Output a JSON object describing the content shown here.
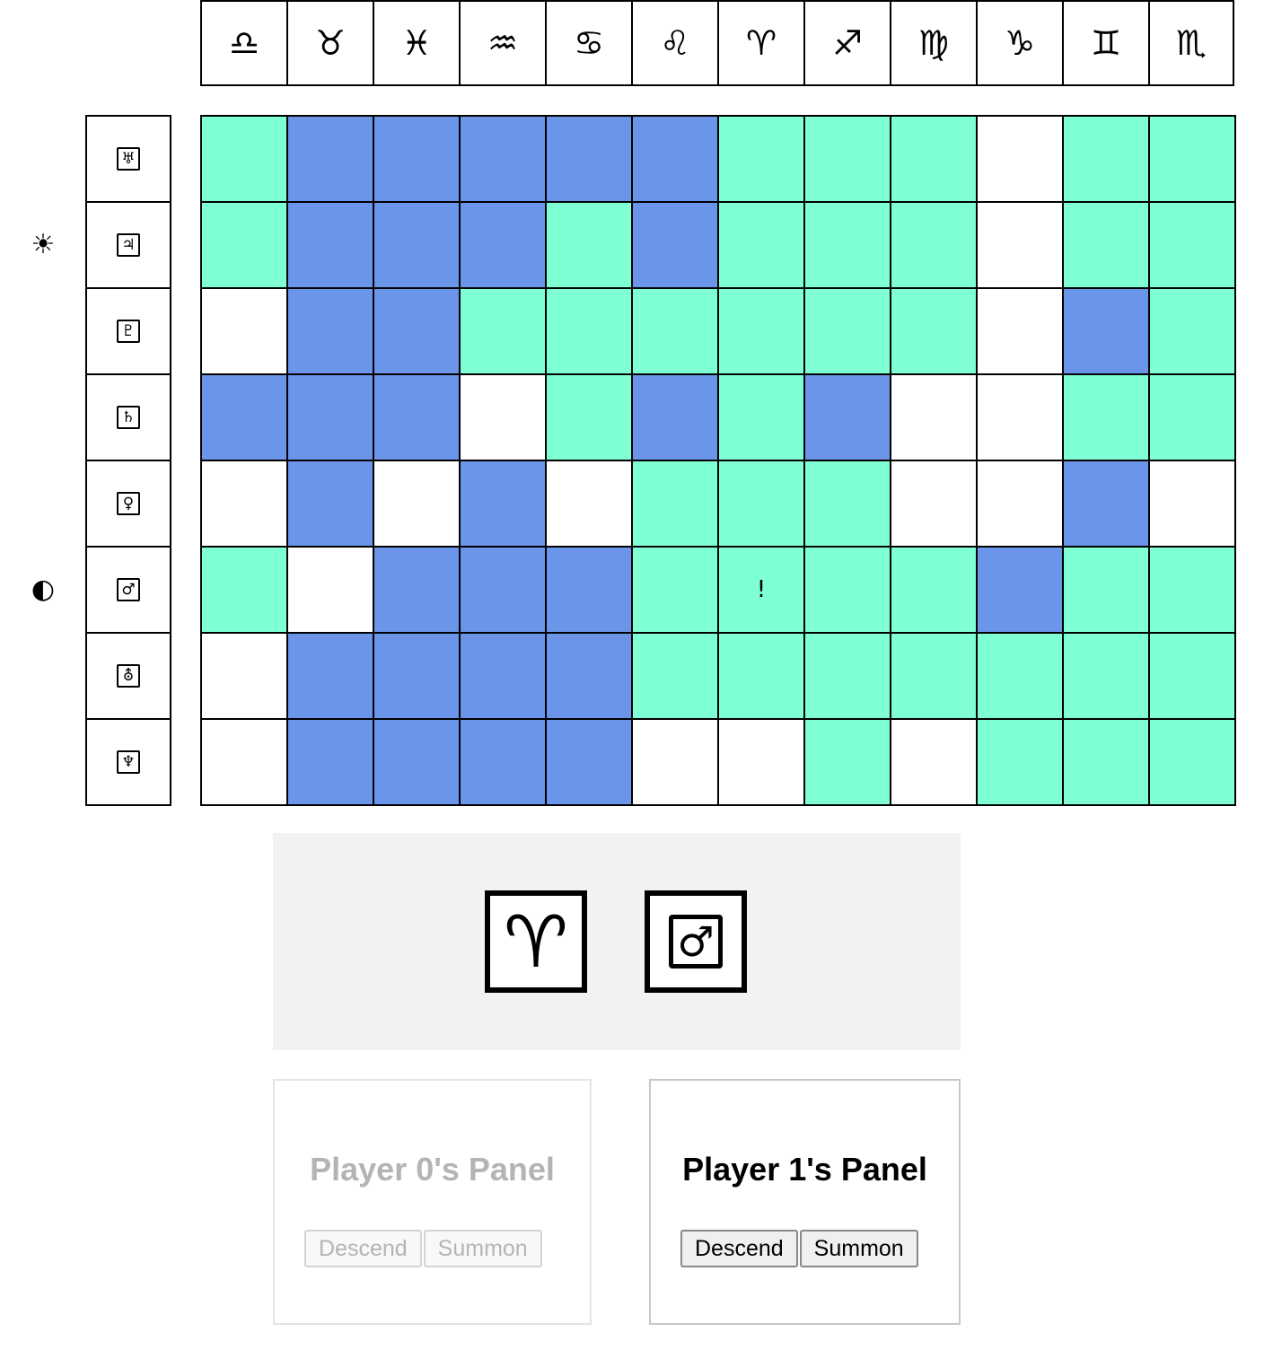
{
  "header": {
    "signs": [
      "♎",
      "♉",
      "♓",
      "♒",
      "♋",
      "♌",
      "♈",
      "♐",
      "♍",
      "♑",
      "♊",
      "♏"
    ],
    "sign_names": [
      "libra-icon",
      "taurus-icon",
      "pisces-icon",
      "aquarius-icon",
      "cancer-icon",
      "leo-icon",
      "aries-icon",
      "sagittarius-icon",
      "virgo-icon",
      "capricorn-icon",
      "gemini-icon",
      "scorpio-icon"
    ]
  },
  "planets": {
    "symbols": [
      "♅",
      "♃",
      "♇",
      "♄",
      "♀",
      "♂",
      "⛢",
      "♆"
    ],
    "names": [
      "uranus-icon",
      "jupiter-icon",
      "pluto-icon",
      "saturn-icon",
      "venus-icon",
      "mars-icon",
      "uranus-alt-icon",
      "neptune-icon"
    ]
  },
  "markers": {
    "sun": "☀",
    "moon": "◐",
    "sun_row": 1,
    "moon_row": 5
  },
  "colors": {
    "type_a": "#7fffd4",
    "type_b": "#6a95e9",
    "empty": "#ffffff"
  },
  "board": {
    "rows": [
      [
        "a",
        "b",
        "b",
        "b",
        "b",
        "b",
        "a",
        "a",
        "a",
        "w",
        "a",
        "a"
      ],
      [
        "a",
        "b",
        "b",
        "b",
        "a",
        "b",
        "a",
        "a",
        "a",
        "w",
        "a",
        "a"
      ],
      [
        "w",
        "b",
        "b",
        "a",
        "a",
        "a",
        "a",
        "a",
        "a",
        "w",
        "b",
        "a"
      ],
      [
        "b",
        "b",
        "b",
        "w",
        "a",
        "b",
        "a",
        "b",
        "w",
        "w",
        "a",
        "a"
      ],
      [
        "w",
        "b",
        "w",
        "b",
        "w",
        "a",
        "a",
        "a",
        "w",
        "w",
        "b",
        "w"
      ],
      [
        "a",
        "w",
        "b",
        "b",
        "b",
        "a",
        "a",
        "a",
        "a",
        "b",
        "a",
        "a"
      ],
      [
        "w",
        "b",
        "b",
        "b",
        "b",
        "a",
        "a",
        "a",
        "a",
        "a",
        "a",
        "a"
      ],
      [
        "w",
        "b",
        "b",
        "b",
        "b",
        "w",
        "w",
        "a",
        "w",
        "a",
        "a",
        "a"
      ]
    ],
    "marks": [
      {
        "row": 5,
        "col": 6,
        "text": "!"
      }
    ]
  },
  "selection": {
    "sign": "♈",
    "planet": "♂"
  },
  "panels": [
    {
      "title": "Player 0's Panel",
      "descend": "Descend",
      "summon": "Summon",
      "active": false
    },
    {
      "title": "Player 1's Panel",
      "descend": "Descend",
      "summon": "Summon",
      "active": true
    }
  ]
}
